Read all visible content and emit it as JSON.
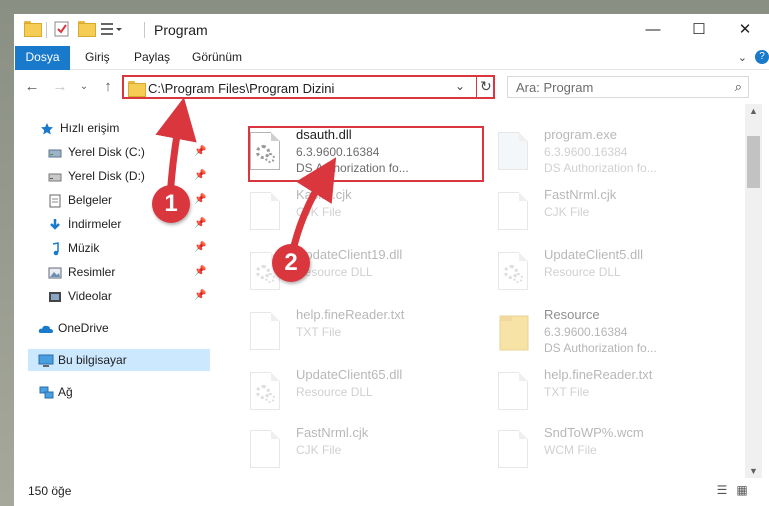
{
  "window": {
    "title": "Program",
    "buttons": {
      "minimize": "—",
      "maximize": "☐",
      "close": "✕"
    }
  },
  "ribbon": {
    "tabs": [
      "Dosya",
      "Giriş",
      "Paylaş",
      "Görünüm"
    ],
    "help": "?"
  },
  "address": {
    "path": "C:\\Program Files\\Program Dizini"
  },
  "search": {
    "placeholder": "Ara: Program"
  },
  "nav": {
    "quick_access": "Hızlı erişim",
    "items": [
      {
        "label": "Yerel Disk (C:)",
        "icon": "drive-icon"
      },
      {
        "label": "Yerel Disk (D:)",
        "icon": "drive-icon"
      },
      {
        "label": "Belgeler",
        "icon": "documents-icon"
      },
      {
        "label": "İndirmeler",
        "icon": "download-icon"
      },
      {
        "label": "Müzik",
        "icon": "music-icon"
      },
      {
        "label": "Resimler",
        "icon": "pictures-icon"
      },
      {
        "label": "Videolar",
        "icon": "videos-icon"
      }
    ],
    "onedrive": "OneDrive",
    "this_pc": "Bu bilgisayar",
    "network": "Ağ"
  },
  "files": [
    {
      "name": "dsauth.dll",
      "line2": "6.3.9600.16384",
      "line3": "DS Authorization fo...",
      "icon": "dll-icon",
      "highlighted": true
    },
    {
      "name": "program.exe",
      "line2": "6.3.9600.16384",
      "line3": "DS Authorization fo...",
      "icon": "exe-icon"
    },
    {
      "name": "Kasim.cjk",
      "line2": "CJK File",
      "line3": "",
      "icon": "file-icon"
    },
    {
      "name": "FastNrml.cjk",
      "line2": "CJK File",
      "line3": "",
      "icon": "file-icon"
    },
    {
      "name": "UpdateClient19.dll",
      "line2": "Resource DLL",
      "line3": "",
      "icon": "dll-icon"
    },
    {
      "name": "UpdateClient5.dll",
      "line2": "Resource DLL",
      "line3": "",
      "icon": "dll-icon"
    },
    {
      "name": "help.fineReader.txt",
      "line2": "TXT File",
      "line3": "",
      "icon": "file-icon"
    },
    {
      "name": "Resource",
      "line2": "6.3.9600.16384",
      "line3": "DS Authorization fo...",
      "icon": "folder-icon"
    },
    {
      "name": "UpdateClient65.dll",
      "line2": "Resource DLL",
      "line3": "",
      "icon": "dll-icon"
    },
    {
      "name": "help.fineReader.txt",
      "line2": "TXT File",
      "line3": "",
      "icon": "file-icon"
    },
    {
      "name": "FastNrml.cjk",
      "line2": "CJK File",
      "line3": "",
      "icon": "file-icon"
    },
    {
      "name": "SndToWP%.wcm",
      "line2": "WCM File",
      "line3": "",
      "icon": "file-icon"
    }
  ],
  "status": {
    "count": "150 öğe"
  },
  "annotations": {
    "badge1": "1",
    "badge2": "2"
  },
  "colors": {
    "accent": "#1979ca",
    "highlight": "#d9363e",
    "selected": "#cce8ff"
  }
}
